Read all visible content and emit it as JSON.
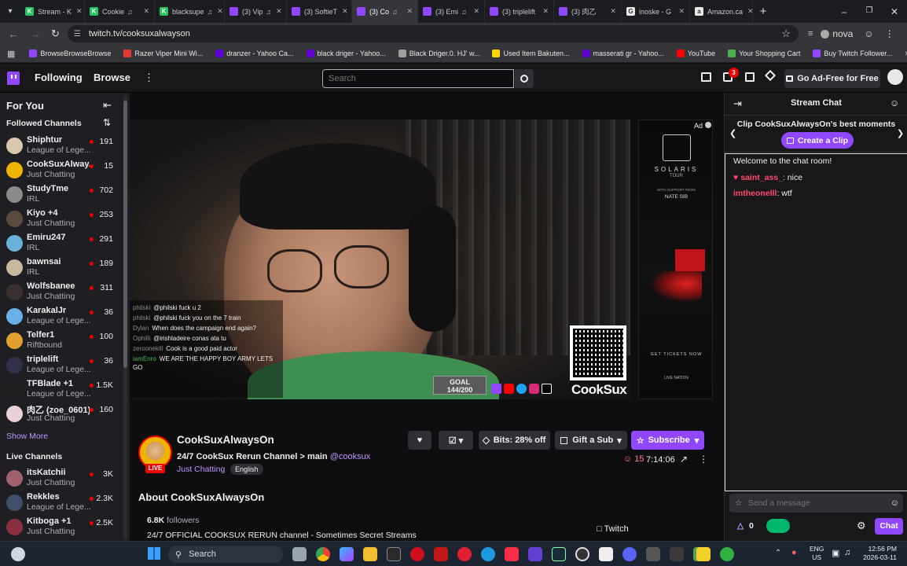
{
  "browser": {
    "tabs": [
      {
        "label": "Stream - K",
        "color": "#22c55e",
        "fav": "K",
        "audio": false
      },
      {
        "label": "Cookie",
        "color": "#22c55e",
        "fav": "K",
        "audio": true
      },
      {
        "label": "blacksupe",
        "color": "#22c55e",
        "fav": "K",
        "audio": true
      },
      {
        "label": "(3) Vip",
        "color": "#9146ff",
        "fav": "",
        "audio": true
      },
      {
        "label": "(3) SoftieT",
        "color": "#9146ff",
        "fav": "",
        "audio": false
      },
      {
        "label": "(3) Co",
        "color": "#9146ff",
        "fav": "",
        "audio": true
      },
      {
        "label": "(3) Emi",
        "color": "#9146ff",
        "fav": "",
        "audio": true
      },
      {
        "label": "(3) triplelift",
        "color": "#9146ff",
        "fav": "",
        "audio": false
      },
      {
        "label": "(3) 肉乙",
        "color": "#9146ff",
        "fav": "",
        "audio": false
      },
      {
        "label": "inoske - G",
        "color": "#e8e8e8",
        "fav": "G",
        "audio": false
      },
      {
        "label": "Amazon.ca",
        "color": "#e8e8e8",
        "fav": "a",
        "audio": false
      }
    ],
    "url": "twitch.tv/cooksuxalwayson",
    "profile_name": "nova",
    "bookmarks": [
      {
        "label": "BrowseBrowseBrowse",
        "color": "#9146ff"
      },
      {
        "label": "Razer Viper Mini Wi...",
        "color": "#e53935"
      },
      {
        "label": "dranzer - Yahoo Ca...",
        "color": "#6001d2"
      },
      {
        "label": "black driger - Yahoo...",
        "color": "#6001d2"
      },
      {
        "label": "Black Driger.0. HJ' w...",
        "color": "#9e9e9e"
      },
      {
        "label": "Used Item Bakuten...",
        "color": "#ffd600"
      },
      {
        "label": "masserati gr - Yahoo...",
        "color": "#6001d2"
      },
      {
        "label": "YouTube",
        "color": "#ff0000"
      },
      {
        "label": "Your Shopping Cart",
        "color": "#4caf50"
      },
      {
        "label": "Buy Twitch Follower...",
        "color": "#9146ff"
      }
    ]
  },
  "twitch_nav": {
    "following": "Following",
    "browse": "Browse",
    "search_placeholder": "Search",
    "notif_count": "3",
    "ad_free": "Go Ad-Free for Free"
  },
  "sidebar": {
    "for_you": "For You",
    "followed_header": "Followed Channels",
    "followed": [
      {
        "name": "Shiphtur",
        "game": "League of Lege...",
        "viewers": "191",
        "color": "#d8c8b0"
      },
      {
        "name": "CookSuxAlway...",
        "game": "Just Chatting",
        "viewers": "15",
        "color": "#f0b400"
      },
      {
        "name": "StudyTme",
        "game": "IRL",
        "viewers": "702",
        "color": "#8a8a8a"
      },
      {
        "name": "Kiyo +4",
        "game": "Just Chatting",
        "viewers": "253",
        "color": "#5a4a40"
      },
      {
        "name": "Emiru247",
        "game": "IRL",
        "viewers": "291",
        "color": "#6ab0d8"
      },
      {
        "name": "bawnsai",
        "game": "IRL",
        "viewers": "189",
        "color": "#c8b8a0"
      },
      {
        "name": "Wolfsbanee",
        "game": "Just Chatting",
        "viewers": "311",
        "color": "#3a3030"
      },
      {
        "name": "KarakalJr",
        "game": "League of Lege...",
        "viewers": "36",
        "color": "#6ab0e8"
      },
      {
        "name": "Telfer1",
        "game": "Riftbound",
        "viewers": "100",
        "color": "#e0a030"
      },
      {
        "name": "triplelift",
        "game": "League of Lege...",
        "viewers": "36",
        "color": "#303048"
      },
      {
        "name": "TFBlade +1",
        "game": "League of Lege...",
        "viewers": "1.5K",
        "color": "#202020"
      },
      {
        "name": "肉乙 (zoe_0601)",
        "game": "Just Chatting",
        "viewers": "160",
        "color": "#e8d0d8"
      }
    ],
    "show_more": "Show More",
    "live_header": "Live Channels",
    "live": [
      {
        "name": "itsKatchii",
        "game": "Just Chatting",
        "viewers": "3K",
        "color": "#a06070"
      },
      {
        "name": "Rekkles",
        "game": "League of Lege...",
        "viewers": "2.3K",
        "color": "#40506a"
      },
      {
        "name": "Kitboga +1",
        "game": "Just Chatting",
        "viewers": "2.5K",
        "color": "#8a3040"
      }
    ]
  },
  "video": {
    "ad_label": "Ad",
    "overlay_chat": [
      {
        "user": "philski",
        "msg": "@philski fuck u 2",
        "color": "#8a8a8a"
      },
      {
        "user": "philski",
        "msg": "@philski fuck you on the 7 train",
        "color": "#8a8a8a"
      },
      {
        "user": "Dylan",
        "msg": "When does the campaign end again?",
        "color": "#8a8a8a"
      },
      {
        "user": "Ophilli",
        "msg": "@irishladeire conas ata tu",
        "color": "#8a8a8a"
      },
      {
        "user": "zeroonekill",
        "msg": "Cook is a good paid actor",
        "color": "#8a8a8a"
      },
      {
        "user": "iamEnro",
        "msg": "WE ARE THE HAPPY BOY ARMY LETS GO",
        "color": "#4caf50"
      }
    ],
    "goal_label": "GOAL",
    "goal_progress": "144/200",
    "brand": "CookSux",
    "ad_poster": {
      "title": "SOLARIS",
      "subtitle": "TOUR",
      "support": "WITH SUPPORT FROM",
      "artist": "NATE SIB",
      "cta": "GET TICKETS NOW",
      "sponsor": "LIVE NATION"
    }
  },
  "channel": {
    "name": "CookSuxAlwaysOn",
    "title": "24/7 CookSux Rerun Channel > main",
    "mention": "@cooksux",
    "category": "Just Chatting",
    "tag": "English",
    "live_badge": "LIVE",
    "viewers": "15",
    "uptime": "7:14:06",
    "bits": "Bits: 28% off",
    "gift": "Gift a Sub",
    "subscribe": "Subscribe",
    "about_title": "About CookSuxAlwaysOn",
    "followers_count": "6.8K",
    "followers_label": "followers",
    "description": "24/7 OFFICIAL COOKSUX RERUN channel - Sometimes Secret Streams",
    "twitch_link": "Twitch"
  },
  "chat": {
    "title": "Stream Chat",
    "clip_text": "Clip CookSuxAlwaysOn's best moments",
    "create_clip": "Create a Clip",
    "welcome": "Welcome to the chat room!",
    "messages": [
      {
        "user": "saint_ass_",
        "text": "nice",
        "color": "#ff4a6a"
      },
      {
        "user": "imtheonelll",
        "text": "wtf",
        "color": "#ff4a6a"
      }
    ],
    "input_placeholder": "Send a message",
    "points": "0",
    "chat_button": "Chat"
  },
  "taskbar": {
    "search": "Search",
    "lang1": "ENG",
    "lang2": "US",
    "time": "12:56 PM",
    "date": "2026-03-11"
  }
}
